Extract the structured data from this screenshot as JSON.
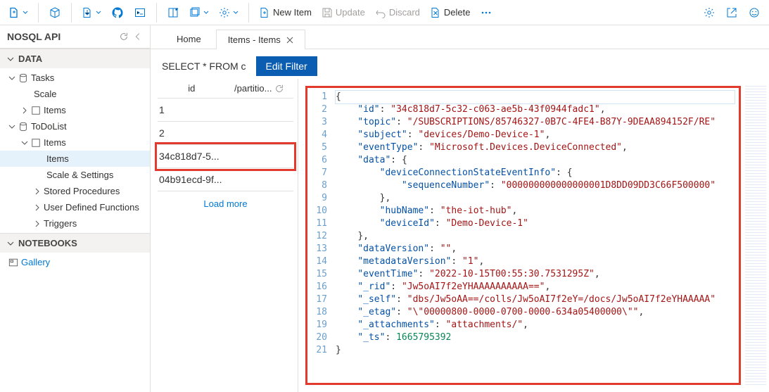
{
  "toolbar": {
    "new_item": "New Item",
    "update": "Update",
    "discard": "Discard",
    "delete": "Delete"
  },
  "api_title": "NOSQL API",
  "sections": {
    "data": "DATA",
    "notebooks": "NOTEBOOKS"
  },
  "tree": {
    "tasks": "Tasks",
    "scale": "Scale",
    "tasks_items": "Items",
    "todolist": "ToDoList",
    "todo_items_folder": "Items",
    "todo_items_leaf": "Items",
    "scale_settings": "Scale & Settings",
    "stored_procs": "Stored Procedures",
    "udf": "User Defined Functions",
    "triggers": "Triggers",
    "gallery": "Gallery"
  },
  "tabs": {
    "home": "Home",
    "items": "Items - Items"
  },
  "filter": {
    "query": "SELECT * FROM c",
    "edit_button": "Edit Filter"
  },
  "items_list": {
    "col_id": "id",
    "col_pk": "/partitio...",
    "rows": [
      "1",
      "2",
      "34c818d7-5...",
      "04b91ecd-9f..."
    ],
    "highlighted_index": 2,
    "load_more": "Load more"
  },
  "json_doc": {
    "id": "34c818d7-5c32-c063-ae5b-43f0944fadc1",
    "topic": "/SUBSCRIPTIONS/85746327-0B7C-4FE4-B87Y-9DEAA894152F/RE",
    "subject": "devices/Demo-Device-1",
    "eventType": "Microsoft.Devices.DeviceConnected",
    "data": {
      "deviceConnectionStateEventInfo": {
        "sequenceNumber": "000000000000000001D8DD09DD3C66F500000"
      },
      "hubName": "the-iot-hub",
      "deviceId": "Demo-Device-1"
    },
    "dataVersion": "",
    "metadataVersion": "1",
    "eventTime": "2022-10-15T00:55:30.7531295Z",
    "_rid": "Jw5oAI7f2eYHAAAAAAAAAA==",
    "_self": "dbs/Jw5oAA==/colls/Jw5oAI7f2eY=/docs/Jw5oAI7f2eYHAAAAA",
    "_etag": "\\\"00000800-0000-0700-0000-634a05400000\\\"",
    "_attachments": "attachments/",
    "_ts": 1665795392
  }
}
